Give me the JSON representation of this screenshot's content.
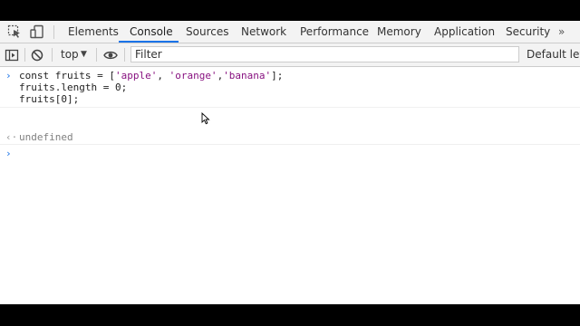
{
  "tabs": [
    {
      "label": "Elements"
    },
    {
      "label": "Console",
      "active": true
    },
    {
      "label": "Sources"
    },
    {
      "label": "Network"
    },
    {
      "label": "Performance"
    },
    {
      "label": "Memory"
    },
    {
      "label": "Application"
    },
    {
      "label": "Security"
    }
  ],
  "tabs_more": "»",
  "icons": {
    "inspect": "element-picker-icon",
    "device": "device-toolbar-icon",
    "sidebar": "console-sidebar-icon",
    "clear": "clear-console-icon",
    "eye": "live-expression-icon"
  },
  "toolbar": {
    "context": "top",
    "context_arrow": "▼",
    "filter_placeholder": "Filter",
    "levels": "Default levels"
  },
  "console": {
    "input_lines": [
      "const fruits = [",
      "'apple'",
      ", ",
      "'orange'",
      ",",
      "'banana'",
      "];"
    ],
    "line2": "fruits.length = 0;",
    "line3": "fruits[0];",
    "result": "undefined",
    "prompt": ""
  },
  "colors": {
    "accent": "#1a73e8",
    "string": "#881280",
    "result": "#808080"
  }
}
